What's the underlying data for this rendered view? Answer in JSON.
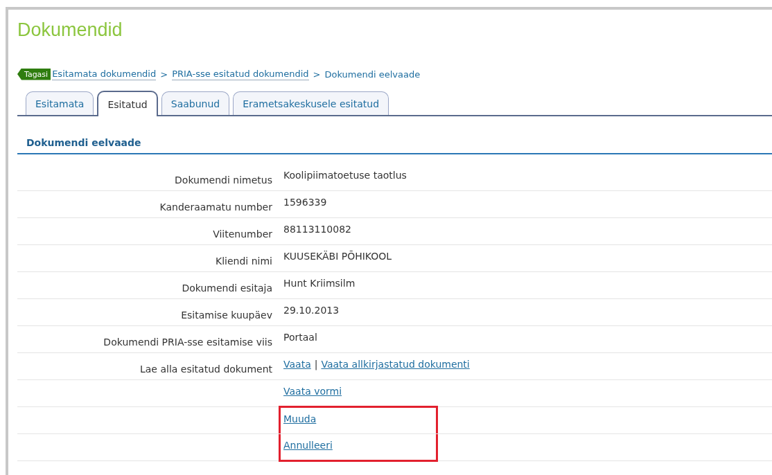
{
  "title": "Dokumendid",
  "back_button": "Tagasi",
  "breadcrumb": [
    {
      "label": "Esitamata dokumendid",
      "kind": "link"
    },
    {
      "label": ">",
      "kind": "sep"
    },
    {
      "label": "PRIA-sse esitatud dokumendid",
      "kind": "link"
    },
    {
      "label": ">",
      "kind": "sep"
    },
    {
      "label": "Dokumendi eelvaade",
      "kind": "current"
    }
  ],
  "tabs": [
    {
      "label": "Esitamata",
      "selected": false
    },
    {
      "label": "Esitatud",
      "selected": true
    },
    {
      "label": "Saabunud",
      "selected": false
    },
    {
      "label": "Erametsakeskusele esitatud",
      "selected": false
    }
  ],
  "section_title": "Dokumendi eelvaade",
  "rows": [
    {
      "label": "Dokumendi nimetus",
      "highlighted": false,
      "values": [
        {
          "kind": "text",
          "text": "Koolipiimatoetuse taotlus"
        }
      ]
    },
    {
      "label": "Kanderaamatu number",
      "highlighted": false,
      "values": [
        {
          "kind": "text",
          "text": "1596339"
        }
      ]
    },
    {
      "label": "Viitenumber",
      "highlighted": false,
      "values": [
        {
          "kind": "text",
          "text": "88113110082"
        }
      ]
    },
    {
      "label": "Kliendi nimi",
      "highlighted": false,
      "values": [
        {
          "kind": "text",
          "text": "KUUSEKÄBI PÕHIKOOL"
        }
      ]
    },
    {
      "label": "Dokumendi esitaja",
      "highlighted": false,
      "values": [
        {
          "kind": "text",
          "text": "Hunt Kriimsilm"
        }
      ]
    },
    {
      "label": "Esitamise kuupäev",
      "highlighted": false,
      "values": [
        {
          "kind": "text",
          "text": "29.10.2013"
        }
      ]
    },
    {
      "label": "Dokumendi PRIA-sse esitamise viis",
      "highlighted": false,
      "values": [
        {
          "kind": "text",
          "text": "Portaal"
        }
      ]
    },
    {
      "label": "Lae alla esitatud dokument",
      "highlighted": false,
      "values": [
        {
          "kind": "link",
          "text": "Vaata"
        },
        {
          "kind": "sep",
          "text": "|"
        },
        {
          "kind": "link",
          "text": "Vaata allkirjastatud dokumenti"
        }
      ]
    },
    {
      "highlighted": false,
      "values": [
        {
          "kind": "link",
          "text": "Vaata vormi"
        }
      ]
    },
    {
      "highlighted": true,
      "values": [
        {
          "kind": "link",
          "text": "Muuda"
        }
      ]
    },
    {
      "highlighted": true,
      "values": [
        {
          "kind": "link",
          "text": "Annulleeri"
        }
      ]
    }
  ]
}
